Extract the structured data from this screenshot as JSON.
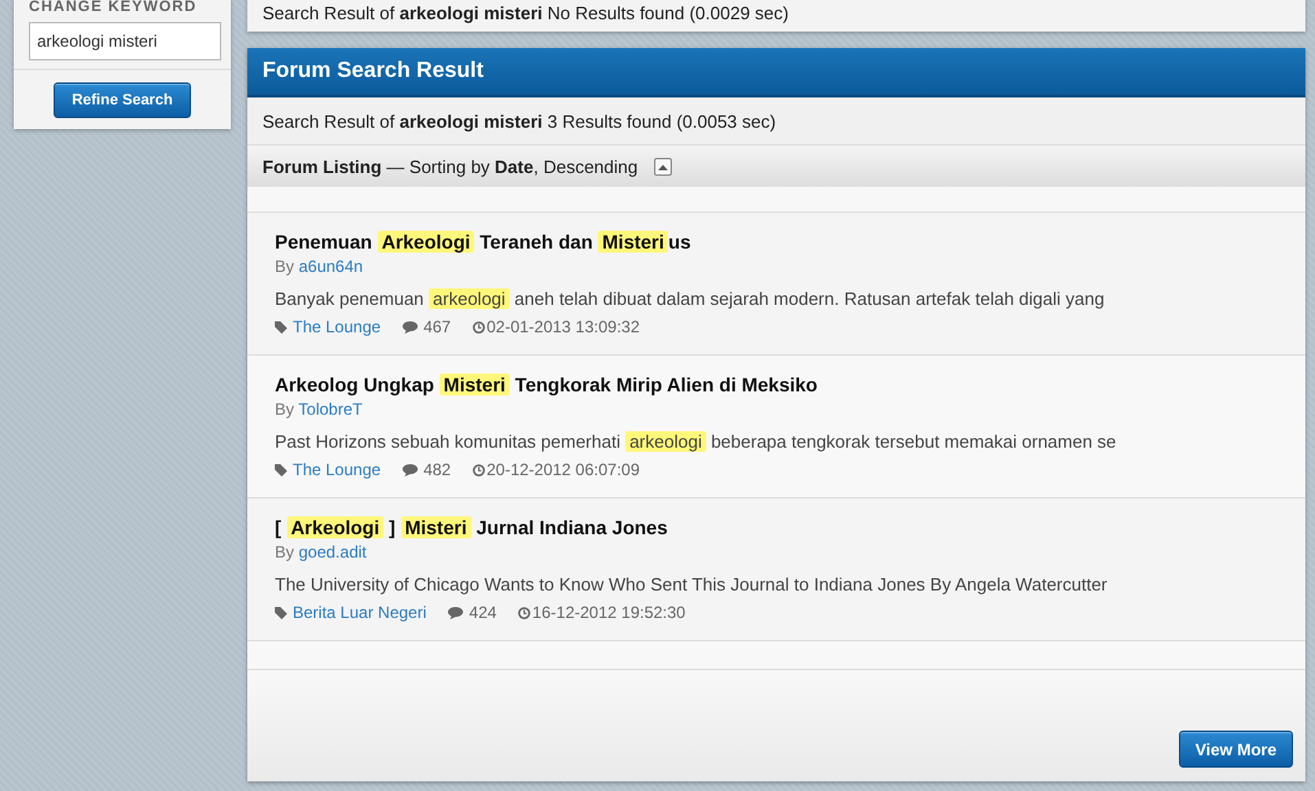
{
  "sidebar": {
    "label": "CHANGE KEYWORD",
    "keyword": "arkeologi misteri",
    "button": "Refine Search"
  },
  "previous_result": {
    "summary": "Search Result of **arkeologi misteri**  No Results found (0.0029 sec)"
  },
  "forum": {
    "title": "Forum Search Result",
    "summary": "Search Result of **arkeologi misteri** 3 Results found (0.0053 sec)",
    "listing": "**Forum Listing** — Sorting by **Date**, Descending",
    "posts": [
      {
        "title": [
          {
            "text": "Penemuan ",
            "highlight": false
          },
          {
            "text": "Arkeologi",
            "highlight": true
          },
          {
            "text": " Teraneh dan ",
            "highlight": false
          },
          {
            "text": "Misteri",
            "highlight": true
          },
          {
            "text": "us",
            "highlight": false
          }
        ],
        "by": "By",
        "author": "a6un64n",
        "excerpt": [
          {
            "text": "Banyak penemuan ",
            "highlight": false
          },
          {
            "text": "arkeologi",
            "highlight": true
          },
          {
            "text": " aneh telah dibuat dalam sejarah modern. Ratusan artefak telah digali yang",
            "highlight": false
          }
        ],
        "forum": "The Lounge",
        "replies": "467",
        "date": "02-01-2013 13:09:32"
      },
      {
        "title": [
          {
            "text": "Arkeolog Ungkap ",
            "highlight": false
          },
          {
            "text": "Misteri",
            "highlight": true
          },
          {
            "text": " Tengkorak Mirip Alien di Meksiko",
            "highlight": false
          }
        ],
        "by": "By",
        "author": "TolobreT",
        "excerpt": [
          {
            "text": "Past Horizons sebuah komunitas pemerhati ",
            "highlight": false
          },
          {
            "text": "arkeologi",
            "highlight": true
          },
          {
            "text": " beberapa tengkorak tersebut memakai ornamen se",
            "highlight": false
          }
        ],
        "forum": "The Lounge",
        "replies": "482",
        "date": "20-12-2012 06:07:09"
      },
      {
        "title": [
          {
            "text": "[ ",
            "highlight": false
          },
          {
            "text": "Arkeologi",
            "highlight": true
          },
          {
            "text": " ] ",
            "highlight": false
          },
          {
            "text": "Misteri",
            "highlight": true
          },
          {
            "text": " Jurnal Indiana Jones",
            "highlight": false
          }
        ],
        "by": "By",
        "author": "goed.adit",
        "excerpt": [
          {
            "text": "The University of Chicago Wants to Know Who Sent This Journal to Indiana Jones By Angela Watercutter",
            "highlight": false
          }
        ],
        "forum": "Berita Luar Negeri",
        "replies": "424",
        "date": "16-12-2012 19:52:30"
      }
    ],
    "button": "View More"
  }
}
